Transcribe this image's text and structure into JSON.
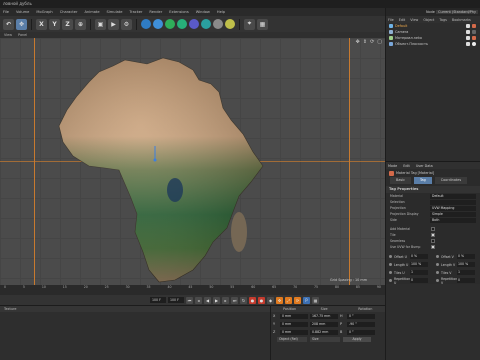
{
  "window": {
    "title": "ловной дубль"
  },
  "menu": [
    "File",
    "Volume",
    "MoGraph",
    "Character",
    "Animate",
    "Simulate",
    "Tracker",
    "Render",
    "Extensions",
    "Window",
    "Help"
  ],
  "toolbar": {
    "axis_buttons": [
      "X",
      "Y",
      "Z"
    ]
  },
  "viewport": {
    "menu": [
      "View",
      "Panel"
    ],
    "grid_spacing": "Grid Spacing : 10 mm"
  },
  "timeline": {
    "ticks": [
      "0",
      "5",
      "10",
      "15",
      "20",
      "25",
      "30",
      "35",
      "40",
      "45",
      "50",
      "55",
      "60",
      "65",
      "70",
      "75",
      "80",
      "85",
      "90"
    ],
    "start_frame": "0 F",
    "current_frame": "0 F",
    "end_frame": "100 F",
    "preview_end": "100 F"
  },
  "material_panel": {
    "header": "Texture"
  },
  "coords": {
    "headers": [
      "Position",
      "Size",
      "Rotation"
    ],
    "rows": [
      {
        "axis": "X",
        "pos": "0 mm",
        "size": "167.75 mm",
        "rot_label": "H",
        "rot": "0 °"
      },
      {
        "axis": "Y",
        "pos": "0 mm",
        "size": "208 mm",
        "rot_label": "P",
        "rot": "-90 °"
      },
      {
        "axis": "Z",
        "pos": "0 mm",
        "size": "0.882 mm",
        "rot_label": "B",
        "rot": "0 °"
      }
    ],
    "object_mode": "Object (Rel)",
    "size_mode": "Size",
    "apply": "Apply"
  },
  "right": {
    "title_left": "Node Space:",
    "layout": "Current (Standard/Phy",
    "object_menu": [
      "File",
      "Edit",
      "View",
      "Object",
      "Tags",
      "Bookmarks"
    ],
    "objects": [
      {
        "name": "Default",
        "color": "#6fb3e6",
        "active": true
      },
      {
        "name": "Camera",
        "color": "#8fb0d2",
        "active": false
      },
      {
        "name": "Материал.neko",
        "color": "#9ed08a",
        "active": false
      },
      {
        "name": "Объект.Плоскость",
        "color": "#7aa7d9",
        "active": false
      }
    ],
    "attr_menu": [
      "Mode",
      "Edit",
      "User Data"
    ],
    "tag_title": "Material Tag [Material]",
    "tabs": [
      "Basic",
      "Tag",
      "Coordinates"
    ],
    "active_tab": "Tag",
    "section": "Tag Properties",
    "props": [
      {
        "label": "Material",
        "value": "Default"
      },
      {
        "label": "Selection",
        "value": ""
      },
      {
        "label": "Projection",
        "value": "UVW Mapping"
      },
      {
        "label": "Projection Display",
        "value": "Simple"
      },
      {
        "label": "Side",
        "value": "Both"
      }
    ],
    "checks": [
      {
        "label": "Add Material",
        "on": false
      },
      {
        "label": "Tile",
        "on": true
      },
      {
        "label": "Seamless",
        "on": false
      },
      {
        "label": "Use UVW for Bump",
        "on": true
      }
    ],
    "uv": [
      {
        "label": "Offset U",
        "value": "0 %"
      },
      {
        "label": "Offset V",
        "value": "0 %"
      },
      {
        "label": "Length U",
        "value": "100 %"
      },
      {
        "label": "Length V",
        "value": "100 %"
      },
      {
        "label": "Tiles U",
        "value": "1"
      },
      {
        "label": "Tiles V",
        "value": "1"
      },
      {
        "label": "Repetitions U",
        "value": "0"
      },
      {
        "label": "Repetitions V",
        "value": "0"
      }
    ]
  }
}
